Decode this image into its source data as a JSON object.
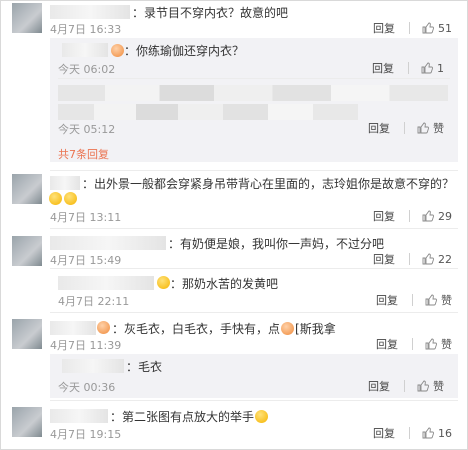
{
  "ui": {
    "reply_label": "回复",
    "like_label": "赞",
    "accent": "#eb7350"
  },
  "comments": [
    {
      "text": "：录节目不穿内衣？故意的吧",
      "time": "4月7日 16:33",
      "likes": "51"
    },
    {
      "text": "：出外景一般都会穿紧身吊带背心在里面的，志玲姐你是故意不穿的？",
      "time": "4月7日 13:11",
      "likes": "29"
    },
    {
      "text": "：有奶便是娘，我叫你一声妈，不过分吧",
      "time": "4月7日 15:49",
      "likes": "22"
    },
    {
      "text": "：那奶水苦的发黄吧",
      "time": "4月7日 22:11",
      "likes": ""
    },
    {
      "text": "：灰毛衣，白毛衣，手快有，点",
      "text2": "[斯我拿",
      "time": "4月7日 11:39",
      "likes": ""
    },
    {
      "text": "：第二张图有点放大的举手",
      "time": "4月7日 19:15",
      "likes": "16"
    }
  ],
  "replies": [
    {
      "text": "：你练瑜伽还穿内衣？",
      "time": "今天 06:02",
      "likes": "1"
    },
    {
      "time": "今天 05:12"
    },
    {
      "text": "：毛衣",
      "time": "今天 00:36"
    }
  ],
  "more_replies": "共7条回复"
}
